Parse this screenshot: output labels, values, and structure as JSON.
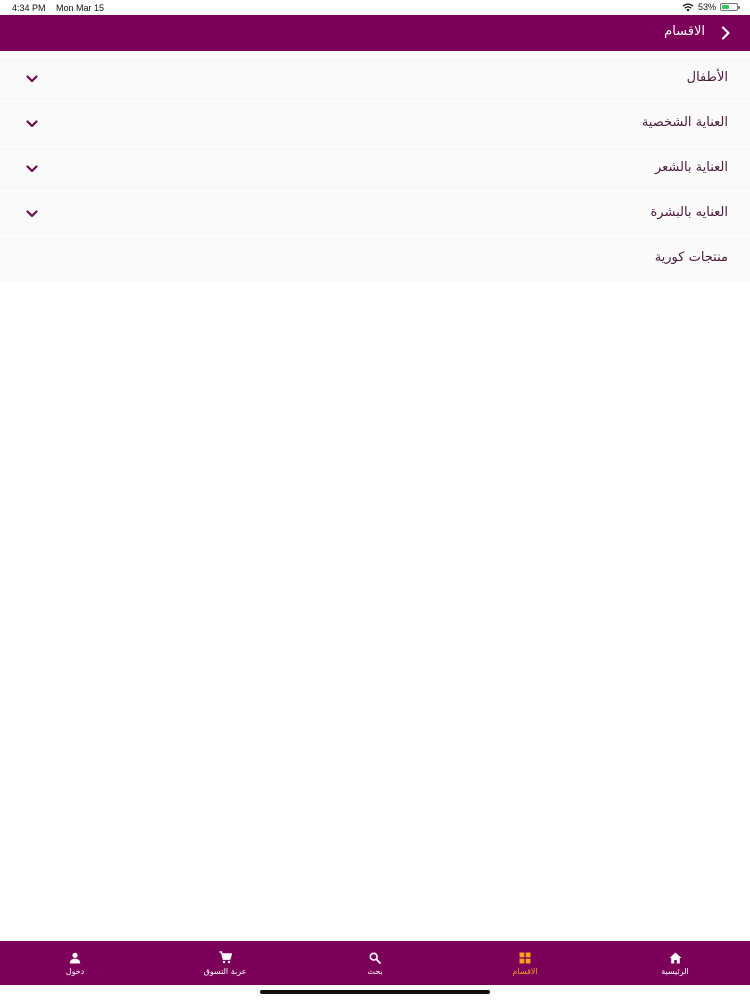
{
  "status_bar": {
    "time": "4:34 PM",
    "date": "Mon Mar 15",
    "battery_text": "53%",
    "battery_level": 0.53
  },
  "header": {
    "title": "الاقسام",
    "background_color": "#7c005a",
    "back_icon": "chevron-right-icon"
  },
  "categories": [
    {
      "label": "الأطفال",
      "expandable": true
    },
    {
      "label": "العناية الشخصية",
      "expandable": true
    },
    {
      "label": "العناية بالشعر",
      "expandable": true
    },
    {
      "label": "العنايه بالبشرة",
      "expandable": true
    },
    {
      "label": "منتجات كورية",
      "expandable": false
    }
  ],
  "bottom_nav": {
    "items": [
      {
        "label": "دخول",
        "icon": "person-icon",
        "active": false
      },
      {
        "label": "عربة التسوق",
        "icon": "cart-icon",
        "active": false
      },
      {
        "label": "بحث",
        "icon": "search-icon",
        "active": false
      },
      {
        "label": "الاقسام",
        "icon": "grid-icon",
        "active": true
      },
      {
        "label": "الرئيسية",
        "icon": "home-icon",
        "active": false
      }
    ],
    "active_color": "#f7a21b"
  }
}
